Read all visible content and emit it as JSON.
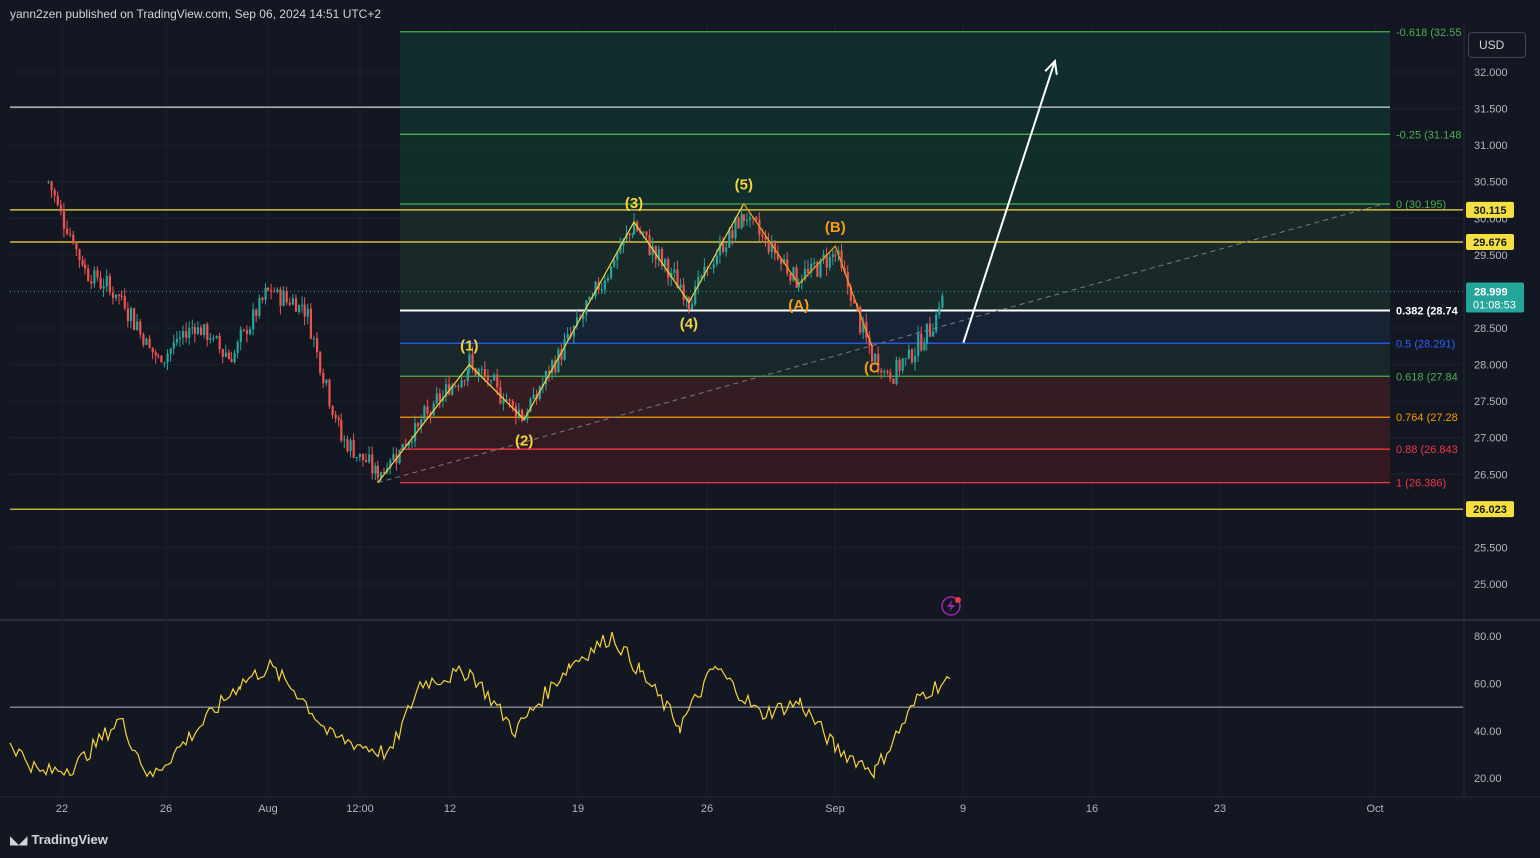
{
  "header": {
    "published_by": "yann2zen published on TradingView.com, Sep 06, 2024 14:51 UTC+2"
  },
  "footer": {
    "brand": "TradingView"
  },
  "currency_button": "USD",
  "colors": {
    "background": "#131722",
    "candle_up": "#26a69a",
    "candle_down": "#ef5350",
    "wave_impulse": "#f5d33c",
    "wave_corrective": "#f59d1b",
    "rsi_line": "#f5d33c",
    "fib_green": "#4caf50",
    "fib_blue": "#2962ff",
    "fib_orange": "#ff9800",
    "fib_red": "#f23645",
    "level_yellow": "#f5e041"
  },
  "chart_data": {
    "type": "candlestick",
    "symbol_currency": "USD",
    "price_axis_ticks": [
      "32.000",
      "31.500",
      "31.000",
      "30.500",
      "30.000",
      "29.500",
      "28.500",
      "28.000",
      "27.500",
      "27.000",
      "26.500",
      "25.500",
      "25.000"
    ],
    "price_ylim": [
      24.55,
      32.95
    ],
    "time_axis_ticks": [
      "22",
      "26",
      "Aug",
      "12:00",
      "12",
      "19",
      "26",
      "Sep",
      "9",
      "16",
      "23",
      "Oct"
    ],
    "rsi_axis_ticks": [
      "80.00",
      "60.00",
      "40.00",
      "20.00"
    ],
    "rsi_ylim": [
      13.0,
      86.0
    ],
    "rsi_midline": 50,
    "current_price": {
      "value": "28.999",
      "countdown": "01:08:53"
    },
    "horizontal_levels": [
      {
        "price": 30.115,
        "label": "30.115",
        "color": "#f5e041"
      },
      {
        "price": 29.676,
        "label": "29.676",
        "color": "#f5e041"
      },
      {
        "price": 26.023,
        "label": "26.023",
        "color": "#f5e041"
      },
      {
        "price": 31.52,
        "label": "",
        "color": "#d1d4dc"
      }
    ],
    "fibonacci": [
      {
        "price": 32.55,
        "label": "-0.618 (32.55",
        "color": "#4caf50"
      },
      {
        "price": 31.148,
        "label": "-0.25 (31.148",
        "color": "#4caf50"
      },
      {
        "price": 30.195,
        "label": "0 (30.195)",
        "color": "#4caf50"
      },
      {
        "price": 28.74,
        "label": "0.382 (28.74",
        "color": "#ffffff"
      },
      {
        "price": 28.291,
        "label": "0.5 (28.291)",
        "color": "#2962ff"
      },
      {
        "price": 27.84,
        "label": "0.618 (27.84",
        "color": "#4caf50"
      },
      {
        "price": 27.28,
        "label": "0.764 (27.28",
        "color": "#ff9800"
      },
      {
        "price": 26.843,
        "label": "0.88 (26.843",
        "color": "#f23645"
      },
      {
        "price": 26.386,
        "label": "1 (26.386)",
        "color": "#f23645"
      }
    ],
    "impulse_wave_points": [
      {
        "date": "Aug 07",
        "price": 26.386
      },
      {
        "date": "Aug 12",
        "price": 28.0
      },
      {
        "date": "Aug 15",
        "price": 27.25
      },
      {
        "date": "Aug 21",
        "price": 29.95
      },
      {
        "date": "Aug 24",
        "price": 28.85
      },
      {
        "date": "Aug 27",
        "price": 30.2
      }
    ],
    "impulse_wave_labels": [
      "(1)",
      "(2)",
      "(3)",
      "(4)",
      "(5)"
    ],
    "corrective_wave_points": [
      {
        "date": "Aug 27",
        "price": 30.2
      },
      {
        "date": "Aug 30",
        "price": 29.1
      },
      {
        "date": "Sep 01",
        "price": 29.62
      },
      {
        "date": "Sep 03",
        "price": 28.25
      }
    ],
    "corrective_wave_labels": [
      "(A)",
      "(B)",
      "(C"
    ],
    "projection_arrow": {
      "from": {
        "date": "Sep 08",
        "price": 28.3
      },
      "to": {
        "date": "Sep 13",
        "price": 32.15
      }
    },
    "trendline_dashed": {
      "from": {
        "date": "Aug 07",
        "price": 26.386
      },
      "to": {
        "date": "Oct 01",
        "price": 30.2
      }
    }
  }
}
